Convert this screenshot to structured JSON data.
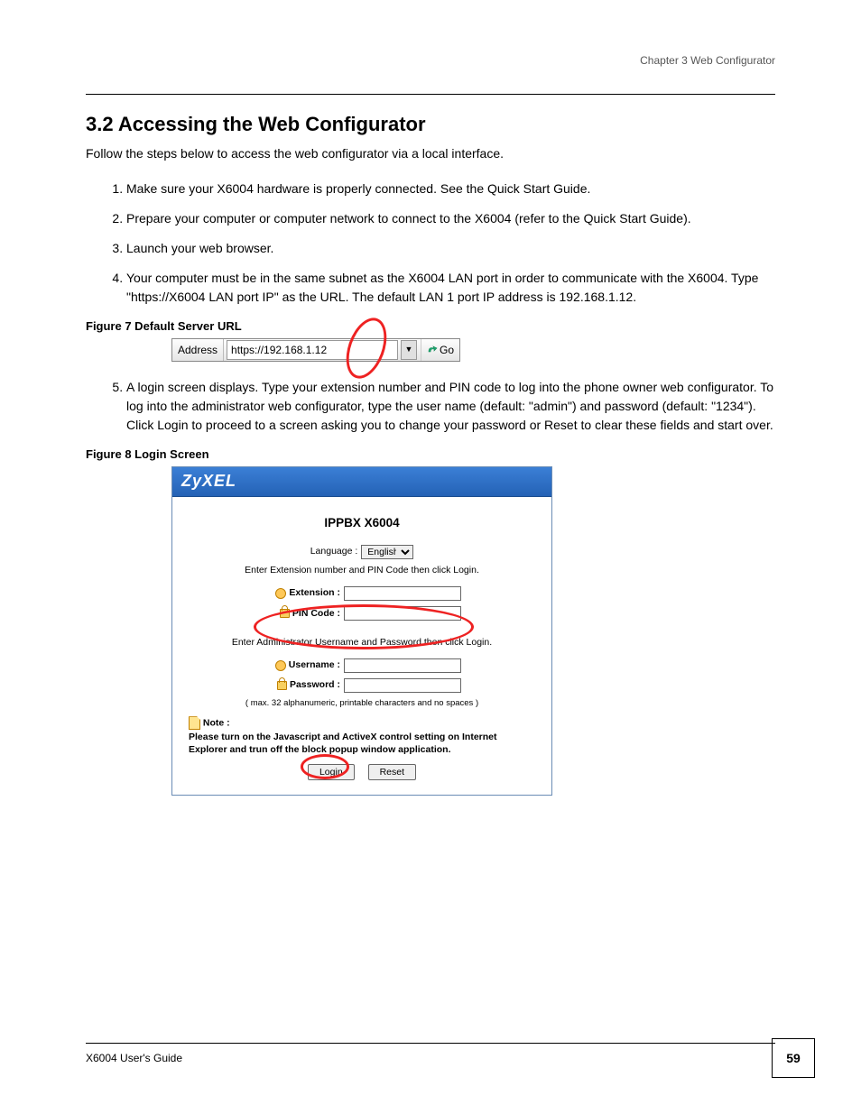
{
  "header": {
    "chapter": "Chapter 3 Web Configurator"
  },
  "section": {
    "number_title": "3.2  Accessing the Web Configurator",
    "intro": "Follow the steps below to access the web configurator via a local interface.",
    "steps": [
      "Make sure your X6004 hardware is properly connected. See the Quick Start Guide.",
      "Prepare your computer or computer network to connect to the X6004 (refer to the Quick Start Guide).",
      "Launch your web browser.",
      "Your computer must be in the same subnet as the X6004 LAN port in order to communicate with the X6004. Type \"https://X6004 LAN port IP\" as the URL. The default LAN 1 port IP address is 192.168.1.12.",
      "A login screen displays. Type your extension number and PIN code to log into the phone owner web configurator. To log into the administrator web configurator, type the user name (default: \"admin\") and password (default: \"1234\"). Click Login to proceed to a screen asking you to change your password or Reset to clear these fields and start over."
    ]
  },
  "figures": {
    "f7": {
      "caption": "Figure 7   Default Server URL",
      "address_label": "Address",
      "url": "https://192.168.1.12",
      "go_label": "Go"
    },
    "f8": {
      "caption": "Figure 8   Login Screen",
      "brand": "ZyXEL",
      "title": "IPPBX X6004",
      "language_label": "Language :",
      "language_value": "English",
      "hint1": "Enter Extension number and PIN Code then click Login.",
      "ext_label": "Extension :",
      "pin_label": "PIN Code :",
      "hint2": "Enter Administrator Username and Password then click Login.",
      "user_label": "Username :",
      "pass_label": "Password :",
      "fine": "( max. 32 alphanumeric, printable characters and no spaces )",
      "note_label": "Note :",
      "note_text": "Please turn on the Javascript and ActiveX control setting on Internet Explorer and trun off the block popup window application.",
      "login_btn": "Login",
      "reset_btn": "Reset"
    }
  },
  "footer": {
    "left": "X6004 User's Guide",
    "page": "59"
  }
}
